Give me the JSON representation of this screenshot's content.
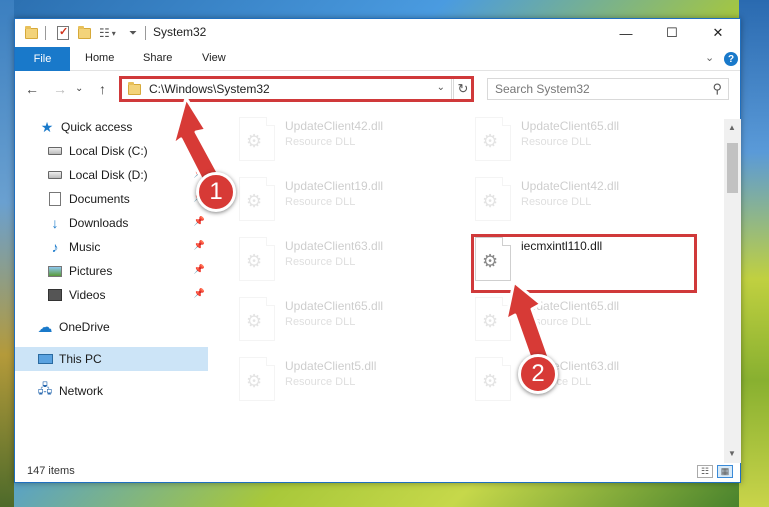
{
  "window": {
    "title": "System32",
    "controls": {
      "minimize": "—",
      "maximize": "☐",
      "close": "✕"
    }
  },
  "ribbon": {
    "tabs": [
      "File",
      "Home",
      "Share",
      "View"
    ],
    "collapse": "⌄",
    "help": "?"
  },
  "nav": {
    "back": "←",
    "forward": "→",
    "recent": "⌄",
    "up": "↑",
    "address": "C:\\Windows\\System32",
    "address_chevron": "⌄",
    "refresh": "↻",
    "search_placeholder": "Search System32",
    "search_icon": "⚲"
  },
  "sidebar": {
    "items": [
      {
        "label": "Quick access",
        "icon": "star-icon"
      },
      {
        "label": "Local Disk (C:)",
        "icon": "disk-icon",
        "pinned": true
      },
      {
        "label": "Local Disk (D:)",
        "icon": "disk-icon",
        "pinned": true
      },
      {
        "label": "Documents",
        "icon": "documents-icon",
        "pinned": true
      },
      {
        "label": "Downloads",
        "icon": "download-icon",
        "pinned": true
      },
      {
        "label": "Music",
        "icon": "music-icon",
        "pinned": true
      },
      {
        "label": "Pictures",
        "icon": "pictures-icon",
        "pinned": true
      },
      {
        "label": "Videos",
        "icon": "videos-icon",
        "pinned": true
      },
      {
        "label": "OneDrive",
        "icon": "cloud-icon"
      },
      {
        "label": "This PC",
        "icon": "computer-icon",
        "selected": true
      },
      {
        "label": "Network",
        "icon": "network-icon"
      }
    ],
    "pin_glyph": "📌"
  },
  "files": [
    {
      "name": "UpdateClient42.dll",
      "type": "Resource DLL",
      "faded": true
    },
    {
      "name": "UpdateClient65.dll",
      "type": "Resource DLL",
      "faded": true
    },
    {
      "name": "UpdateClient19.dll",
      "type": "Resource DLL",
      "faded": true
    },
    {
      "name": "UpdateClient42.dll",
      "type": "Resource DLL",
      "faded": true
    },
    {
      "name": "UpdateClient63.dll",
      "type": "Resource DLL",
      "faded": true
    },
    {
      "name": "iecmxintl110.dll",
      "type": "",
      "faded": false
    },
    {
      "name": "UpdateClient65.dll",
      "type": "Resource DLL",
      "faded": true
    },
    {
      "name": "UpdateClient65.dll",
      "type": "Resource DLL",
      "faded": true
    },
    {
      "name": "UpdateClient5.dll",
      "type": "Resource DLL",
      "faded": true
    },
    {
      "name": "UpdateClient63.dll",
      "type": "Resource DLL",
      "faded": true
    }
  ],
  "status": {
    "item_count": "147 items",
    "details_view": "☷",
    "tiles_view": "▦"
  },
  "annotations": {
    "step1": "1",
    "step2": "2",
    "color": "#d0393a"
  }
}
